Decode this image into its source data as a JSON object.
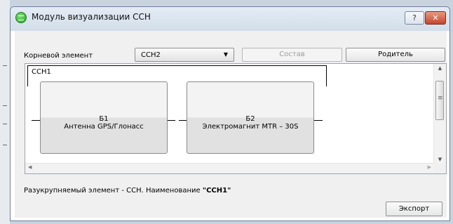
{
  "window": {
    "title": "Модуль визуализации ССН",
    "help_label": "?",
    "close_label": "✕"
  },
  "toolbar": {
    "root_label": "Корневой элемент",
    "root_value": "ССН2",
    "compose_label": "Состав",
    "parent_label": "Родитель"
  },
  "diagram": {
    "group_title": "ССН1",
    "blocks": [
      {
        "id": "Б1",
        "name": "Антенна GPS/Глонасс"
      },
      {
        "id": "Б2",
        "name": "Электромагнит MTR – 30S"
      }
    ]
  },
  "status": {
    "prefix": "Разукрупняемый элемент - ССН. Наименование ",
    "name": "\"ССН1\""
  },
  "footer": {
    "export_label": "Экспорт"
  },
  "colors": {
    "title_bar": "#d9e4f0",
    "close_button": "#c7452a",
    "app_icon": "#27a12b"
  },
  "icons": {
    "app": "green-circle-icon",
    "help": "help-icon",
    "close": "close-icon",
    "combo_arrow": "chevron-down-icon"
  }
}
